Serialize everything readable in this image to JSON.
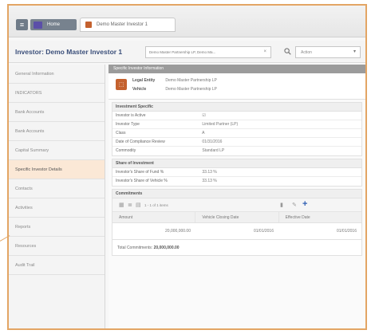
{
  "tabs": {
    "home_label": "Home",
    "document_label": "Demo Master Investor 1"
  },
  "header": {
    "title": "Investor: Demo Master Investor 1",
    "entity_selector_value": "Demo Master Partnership LP, Demo Ma...",
    "action_placeholder": "Action"
  },
  "sidebar": {
    "items": [
      {
        "label": "General Information",
        "active": false
      },
      {
        "label": "INDICATORS",
        "active": false
      },
      {
        "label": "Bank Accounts",
        "active": false
      },
      {
        "label": "Bank Accounts",
        "active": false
      },
      {
        "label": "Capital Summary",
        "active": false
      },
      {
        "label": "Specific Investor Details",
        "active": true
      },
      {
        "label": "Contacts",
        "active": false
      },
      {
        "label": "Activities",
        "active": false
      },
      {
        "label": "Reports",
        "active": false
      },
      {
        "label": "Resources",
        "active": false
      },
      {
        "label": "Audit Trail",
        "active": false
      }
    ]
  },
  "content": {
    "section_title": "Specific Investor Information",
    "legal_entity_label": "Legal Entity",
    "legal_entity_value": "Demo Master Partnership LP",
    "vehicle_label": "Vehicle",
    "vehicle_value": "Demo Master Partnership LP",
    "investment_specific": {
      "title": "Investment Specific",
      "rows": [
        {
          "label": "Investor is Active",
          "value": "☑"
        },
        {
          "label": "Investor Type",
          "value": "Limited Partner (LP)"
        },
        {
          "label": "Class",
          "value": "A"
        },
        {
          "label": "Date of Compliance Review",
          "value": "01/31/2016"
        },
        {
          "label": "Commodity",
          "value": "Standard LP"
        }
      ]
    },
    "share_of_investment": {
      "title": "Share of Investment",
      "rows": [
        {
          "label": "Investor's Share of Fund %",
          "value": "33.13 %"
        },
        {
          "label": "Investor's Share of Vehicle %",
          "value": "33.13 %"
        }
      ]
    },
    "commitments": {
      "title": "Commitments",
      "pager_text": "1 - 1 of 1 items",
      "columns": [
        "Amount",
        "Vehicle Closing Date",
        "Effective Date"
      ],
      "rows": [
        [
          "20,000,000.00",
          "01/01/2016",
          "01/01/2016"
        ]
      ],
      "total_label": "Total Commitments:",
      "total_value": "20,000,000.00"
    }
  },
  "colors": {
    "frame_border": "#e3a564",
    "active_nav_bg": "#fbe8d6",
    "title_blue": "#3b4f7a",
    "plus_blue": "#2f5fb3",
    "logo_orange": "#c4612e"
  }
}
